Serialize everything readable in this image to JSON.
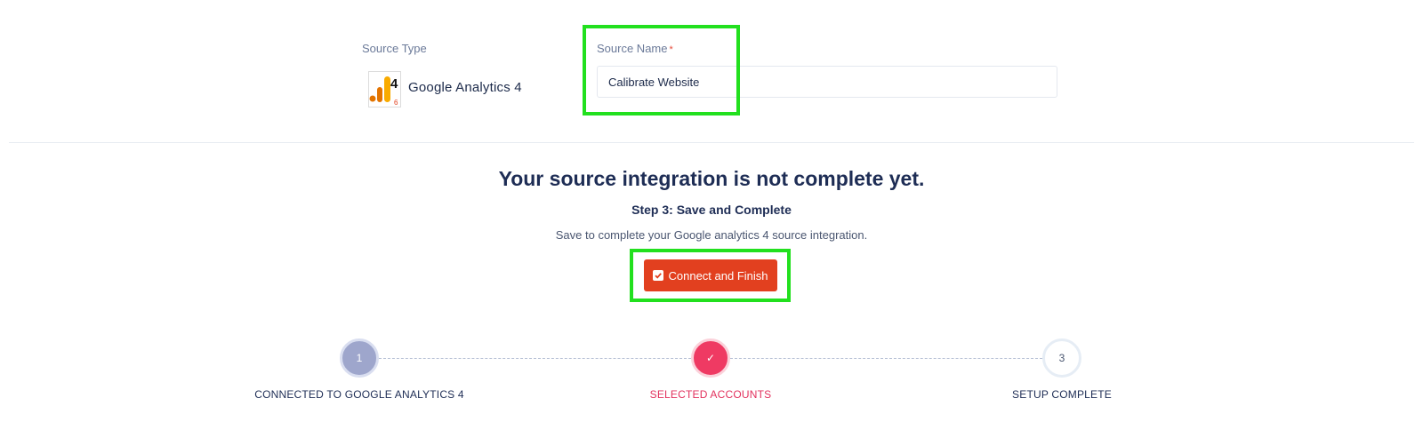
{
  "source_type": {
    "label": "Source Type",
    "value": "Google Analytics 4",
    "logo_icon": "google-analytics-4-logo"
  },
  "source_name": {
    "label": "Source Name",
    "required_mark": "*",
    "value": "Calibrate Website"
  },
  "integration": {
    "headline": "Your source integration is not complete yet.",
    "step_title": "Step 3: Save and Complete",
    "step_description": "Save to complete your Google analytics 4 source integration.",
    "button_label": "Connect and Finish",
    "button_icon": "checkbox-checked-icon",
    "button_color": "#e2401f"
  },
  "progress": {
    "steps": [
      {
        "number": "1",
        "label": "CONNECTED TO GOOGLE ANALYTICS 4",
        "state": "done",
        "color": "#9ea6cc"
      },
      {
        "number": "✓",
        "label": "SELECTED ACCOUNTS",
        "state": "current",
        "color": "#ef3a63"
      },
      {
        "number": "3",
        "label": "SETUP COMPLETE",
        "state": "pending",
        "color": "#ffffff"
      }
    ]
  },
  "highlight_color": "#22e01e"
}
